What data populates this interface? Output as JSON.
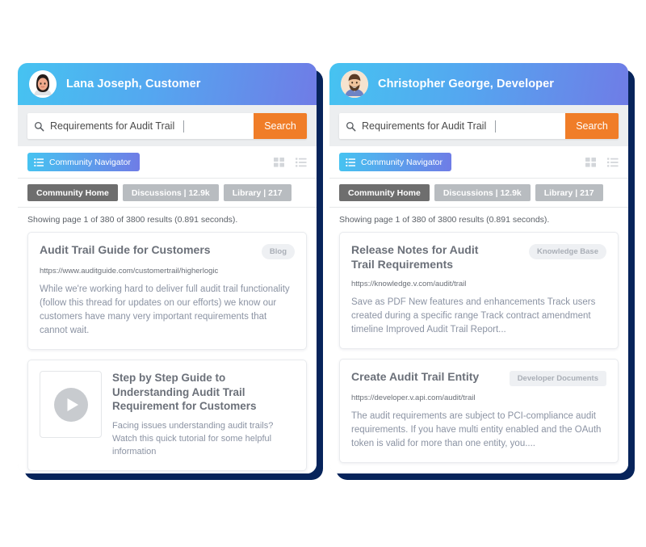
{
  "panels": [
    {
      "id": "customer-panel",
      "header": {
        "user_name": "Lana Joseph, Customer",
        "avatar_icon": "female-avatar-icon"
      },
      "search": {
        "icon": "search-icon",
        "value": "Requirements for Audit Trail",
        "placeholder": "Search",
        "button_label": "Search"
      },
      "navigator": {
        "icon": "list-bullets-icon",
        "label": "Community Navigator"
      },
      "view_toggle": {
        "grid_icon": "grid-view-icon",
        "list_icon": "list-view-icon"
      },
      "tabs": [
        {
          "label": "Community Home",
          "active": true
        },
        {
          "label": "Discussions | 12.9k",
          "active": false
        },
        {
          "label": "Library | 217",
          "active": false
        }
      ],
      "results_status": "Showing page 1 of 380 of 3800 results (0.891 seconds).",
      "cards": [
        {
          "type": "text",
          "title": "Audit Trail Guide for Customers",
          "badge": "Blog",
          "badge_shape": "pill",
          "url": "https://www.auditguide.com/customertrail/higherlogic",
          "description": "While we're working hard to deliver full audit trail functionality (follow this thread for updates on our efforts) we know our customers have many very important requirements that cannot wait."
        },
        {
          "type": "video",
          "thumb_icon": "play-button-icon",
          "title": "Step by Step Guide to Understanding Audit Trail Requirement for Customers",
          "description": "Facing issues understanding audit trails? Watch this quick tutorial for some helpful information"
        }
      ]
    },
    {
      "id": "developer-panel",
      "header": {
        "user_name": "Christopher George, Developer",
        "avatar_icon": "male-avatar-icon"
      },
      "search": {
        "icon": "search-icon",
        "value": "Requirements for Audit Trail",
        "placeholder": "Search",
        "button_label": "Search"
      },
      "navigator": {
        "icon": "list-bullets-icon",
        "label": "Community Navigator"
      },
      "view_toggle": {
        "grid_icon": "grid-view-icon",
        "list_icon": "list-view-icon"
      },
      "tabs": [
        {
          "label": "Community Home",
          "active": true
        },
        {
          "label": "Discussions | 12.9k",
          "active": false
        },
        {
          "label": "Library | 217",
          "active": false
        }
      ],
      "results_status": "Showing page 1 of 380 of 3800 results (0.891 seconds).",
      "cards": [
        {
          "type": "text",
          "title": "Release Notes for Audit Trail Requirements",
          "badge": "Knowledge Base",
          "badge_shape": "pill",
          "url": "https://knowledge.v.com/audit/trail",
          "description": "Save as PDF New features and enhancements Track users created during a specific range Track contract amendment timeline Improved Audit Trail Report..."
        },
        {
          "type": "text",
          "title": "Create Audit Trail Entity",
          "badge": "Developer Documents",
          "badge_shape": "square",
          "url": "https://developer.v.api.com/audit/trail",
          "description": "The audit requirements are subject to PCI-compliance audit requirements. If you have multi entity enabled and the OAuth token is valid for more than one entity, you...."
        }
      ]
    }
  ],
  "colors": {
    "header_gradient_start": "#46c3f1",
    "header_gradient_end": "#6f7ce6",
    "search_button": "#f07d28",
    "panel_shadow": "#07245b",
    "tab_active": "#6e6e6e",
    "tab_inactive": "#b8bcc0",
    "card_title": "#6b7079",
    "card_text": "#8b93a3"
  }
}
